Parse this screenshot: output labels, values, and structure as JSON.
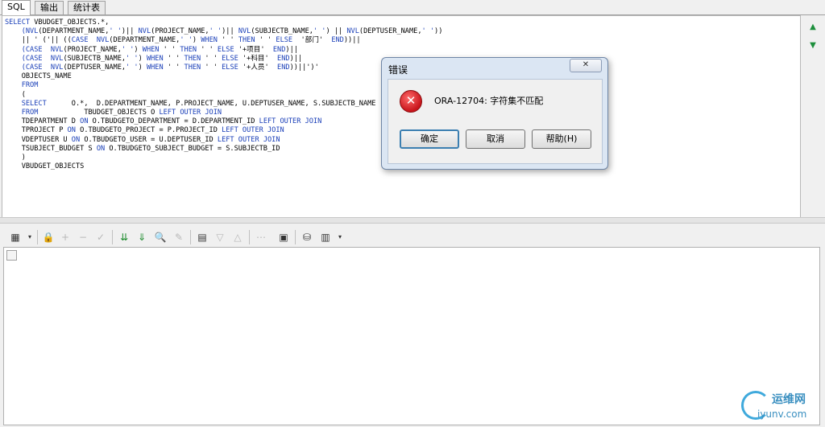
{
  "tabs": [
    "SQL",
    "输出",
    "统计表"
  ],
  "code_lines": [
    [
      {
        "t": "SELECT",
        "k": 1
      },
      {
        "t": " VBUDGET_OBJECTS.*,"
      }
    ],
    [
      {
        "t": "    (NVL",
        "k": 1
      },
      {
        "t": "(DEPARTMENT_NAME,"
      },
      {
        "t": "' '",
        "k": 1
      },
      {
        "t": ")|| "
      },
      {
        "t": "NVL",
        "k": 1
      },
      {
        "t": "(PROJECT_NAME,"
      },
      {
        "t": "' '",
        "k": 1
      },
      {
        "t": ")|| "
      },
      {
        "t": "NVL",
        "k": 1
      },
      {
        "t": "(SUBJECTB_NAME,"
      },
      {
        "t": "' '",
        "k": 1
      },
      {
        "t": ") || "
      },
      {
        "t": "NVL",
        "k": 1
      },
      {
        "t": "(DEPTUSER_NAME,"
      },
      {
        "t": "' '",
        "k": 1
      },
      {
        "t": "))"
      }
    ],
    [
      {
        "t": "    || ' ('|| (("
      },
      {
        "t": "CASE  NVL",
        "k": 1
      },
      {
        "t": "(DEPARTMENT_NAME,"
      },
      {
        "t": "' '",
        "k": 1
      },
      {
        "t": ") "
      },
      {
        "t": "WHEN",
        "k": 1
      },
      {
        "t": " ' ' "
      },
      {
        "t": "THEN",
        "k": 1
      },
      {
        "t": " ' ' "
      },
      {
        "t": "ELSE",
        "k": 1
      },
      {
        "t": "  '部门'  "
      },
      {
        "t": "END",
        "k": 1
      },
      {
        "t": "))||"
      }
    ],
    [
      {
        "t": "    (CASE  NVL",
        "k": 1
      },
      {
        "t": "(PROJECT_NAME,"
      },
      {
        "t": "' '",
        "k": 1
      },
      {
        "t": ") "
      },
      {
        "t": "WHEN",
        "k": 1
      },
      {
        "t": " ' ' "
      },
      {
        "t": "THEN",
        "k": 1
      },
      {
        "t": " ' ' "
      },
      {
        "t": "ELSE",
        "k": 1
      },
      {
        "t": " '+项目'  "
      },
      {
        "t": "END",
        "k": 1
      },
      {
        "t": ")||"
      }
    ],
    [
      {
        "t": "    (CASE  NVL",
        "k": 1
      },
      {
        "t": "(SUBJECTB_NAME,"
      },
      {
        "t": "' '",
        "k": 1
      },
      {
        "t": ") "
      },
      {
        "t": "WHEN",
        "k": 1
      },
      {
        "t": " ' ' "
      },
      {
        "t": "THEN",
        "k": 1
      },
      {
        "t": " ' ' "
      },
      {
        "t": "ELSE",
        "k": 1
      },
      {
        "t": " '+科目'  "
      },
      {
        "t": "END",
        "k": 1
      },
      {
        "t": ")||"
      }
    ],
    [
      {
        "t": "    (CASE  NVL",
        "k": 1
      },
      {
        "t": "(DEPTUSER_NAME,"
      },
      {
        "t": "' '",
        "k": 1
      },
      {
        "t": ") "
      },
      {
        "t": "WHEN",
        "k": 1
      },
      {
        "t": " ' ' "
      },
      {
        "t": "THEN",
        "k": 1
      },
      {
        "t": " ' ' "
      },
      {
        "t": "ELSE",
        "k": 1
      },
      {
        "t": " '+人员'  "
      },
      {
        "t": "END",
        "k": 1
      },
      {
        "t": "))||')'"
      }
    ],
    [
      {
        "t": "    OBJECTS_NAME"
      }
    ],
    [
      {
        "t": "    FROM",
        "k": 1
      }
    ],
    [
      {
        "t": "    ("
      }
    ],
    [
      {
        "t": "    SELECT",
        "k": 1
      },
      {
        "t": "      O.*,  D.DEPARTMENT_NAME, P.PROJECT_NAME, U.DEPTUSER_NAME, S.SUBJECTB_NAME"
      }
    ],
    [
      {
        "t": "    FROM",
        "k": 1
      },
      {
        "t": "           TBUDGET_OBJECTS O "
      },
      {
        "t": "LEFT OUTER JOIN",
        "k": 1
      }
    ],
    [
      {
        "t": "    TDEPARTMENT D "
      },
      {
        "t": "ON",
        "k": 1
      },
      {
        "t": " O.TBUDGETO_DEPARTMENT = D.DEPARTMENT_ID "
      },
      {
        "t": "LEFT OUTER JOIN",
        "k": 1
      }
    ],
    [
      {
        "t": "    TPROJECT P "
      },
      {
        "t": "ON",
        "k": 1
      },
      {
        "t": " O.TBUDGETO_PROJECT = P.PROJECT_ID "
      },
      {
        "t": "LEFT OUTER JOIN",
        "k": 1
      }
    ],
    [
      {
        "t": "    VDEPTUSER U "
      },
      {
        "t": "ON",
        "k": 1
      },
      {
        "t": " O.TBUDGETO_USER = U.DEPTUSER_ID "
      },
      {
        "t": "LEFT OUTER JOIN",
        "k": 1
      }
    ],
    [
      {
        "t": "    TSUBJECT_BUDGET S "
      },
      {
        "t": "ON",
        "k": 1
      },
      {
        "t": " O.TBUDGETO_SUBJECT_BUDGET = S.SUBJECTB_ID"
      }
    ],
    [
      {
        "t": "    )"
      }
    ],
    [
      {
        "t": "    VBUDGET_OBJECTS"
      }
    ]
  ],
  "dialog": {
    "title": "错误",
    "close": "✕",
    "message": "ORA-12704: 字符集不匹配",
    "icon": "error-icon",
    "buttons": {
      "ok": "确定",
      "cancel": "取消",
      "help": "帮助(H)"
    }
  },
  "icons": {
    "scroll_up": "▲",
    "scroll_down": "▼"
  },
  "watermark": {
    "cn": "运维网",
    "en": "iyunv.com"
  },
  "colors": {
    "keyword": "#1a3fb8",
    "error": "#c8141b",
    "accent": "#3c7fb1"
  }
}
